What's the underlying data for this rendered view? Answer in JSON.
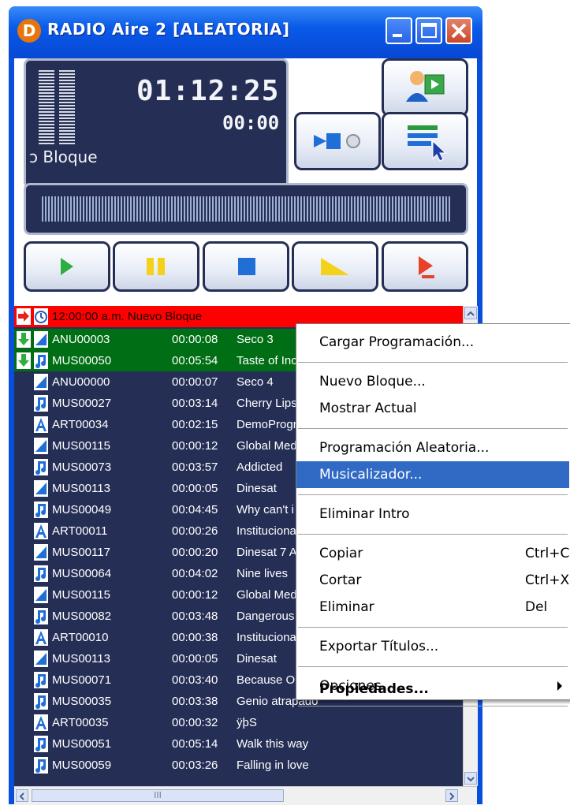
{
  "window": {
    "title": "RADIO Aire 2 [ALEATORIA]",
    "app_icon_letter": "D"
  },
  "display": {
    "time_main": "01:12:25",
    "time_sub": "00:00",
    "status_text": "ɔ Bloque"
  },
  "playlist": {
    "header": {
      "label": "12:00:00 a.m. Nuevo Bloque"
    },
    "rows": [
      {
        "code": "ANU00003",
        "duration": "00:00:08",
        "title": "Seco 3",
        "type": "jingle",
        "highlight": true
      },
      {
        "code": "MUS00050",
        "duration": "00:05:54",
        "title": "Taste of Inc",
        "type": "music",
        "highlight": true
      },
      {
        "code": "ANU00000",
        "duration": "00:00:07",
        "title": "Seco 4",
        "type": "jingle"
      },
      {
        "code": "MUS00027",
        "duration": "00:03:14",
        "title": "Cherry Lips",
        "type": "music"
      },
      {
        "code": "ART00034",
        "duration": "00:02:15",
        "title": "DemoProgr",
        "type": "art"
      },
      {
        "code": "MUS00115",
        "duration": "00:00:12",
        "title": "Global Med",
        "type": "jingle"
      },
      {
        "code": "MUS00073",
        "duration": "00:03:57",
        "title": "Addicted",
        "type": "music"
      },
      {
        "code": "MUS00113",
        "duration": "00:00:05",
        "title": "Dinesat",
        "type": "jingle"
      },
      {
        "code": "MUS00049",
        "duration": "00:04:45",
        "title": "Why can't i",
        "type": "music"
      },
      {
        "code": "ART00011",
        "duration": "00:00:26",
        "title": "Institucional",
        "type": "art"
      },
      {
        "code": "MUS00117",
        "duration": "00:00:20",
        "title": "Dinesat 7 A",
        "type": "jingle"
      },
      {
        "code": "MUS00064",
        "duration": "00:04:02",
        "title": "Nine lives",
        "type": "music"
      },
      {
        "code": "MUS00115",
        "duration": "00:00:12",
        "title": "Global Med",
        "type": "jingle"
      },
      {
        "code": "MUS00082",
        "duration": "00:03:48",
        "title": "Dangerous",
        "type": "music"
      },
      {
        "code": "ART00010",
        "duration": "00:00:38",
        "title": "Institucional",
        "type": "art"
      },
      {
        "code": "MUS00113",
        "duration": "00:00:05",
        "title": "Dinesat",
        "type": "jingle"
      },
      {
        "code": "MUS00071",
        "duration": "00:03:40",
        "title": "Because O",
        "type": "music"
      },
      {
        "code": "MUS00035",
        "duration": "00:03:38",
        "title": "Genio atrapado",
        "type": "music"
      },
      {
        "code": "ART00035",
        "duration": "00:00:32",
        "title": "ÿþS",
        "type": "art"
      },
      {
        "code": "MUS00051",
        "duration": "00:05:14",
        "title": "Walk this way",
        "type": "music"
      },
      {
        "code": "MUS00059",
        "duration": "00:03:26",
        "title": "Falling in love",
        "type": "music"
      }
    ]
  },
  "scrollbar": {
    "thumb_glyph": "III"
  },
  "context_menu": {
    "items": [
      {
        "label": "Cargar Programación..."
      },
      {
        "label": "Nuevo Bloque..."
      },
      {
        "label": "Mostrar Actual"
      },
      {
        "label": "Programación Aleatoria..."
      },
      {
        "label": "Musicalizador...",
        "selected": true
      },
      {
        "label": "Eliminar Intro"
      },
      {
        "label": "Copiar",
        "shortcut": "Ctrl+C"
      },
      {
        "label": "Cortar",
        "shortcut": "Ctrl+X"
      },
      {
        "label": "Eliminar",
        "shortcut": "Del"
      },
      {
        "label": "Exportar Títulos..."
      },
      {
        "label": "Opciones",
        "submenu": true
      },
      {
        "label": "Propiedades...",
        "bold": true
      }
    ]
  },
  "colors": {
    "titlebar": "#0a4fdc",
    "lcd_background": "#252f56",
    "header_row": "#ff0000",
    "current_row": "#006e15",
    "menu_selection": "#316ac5"
  }
}
